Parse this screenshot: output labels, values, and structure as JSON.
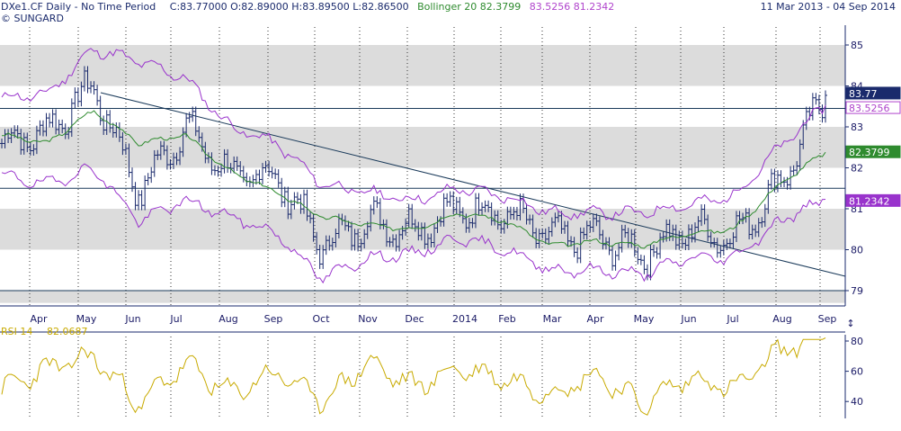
{
  "header": {
    "instrument": "DXe1.CF Daily",
    "sep": " - ",
    "period": "No Time Period",
    "ohlc": "C:83.77000 O:82.89000 H:83.89500 L:82.86500",
    "bb_name": "Bollinger 20",
    "bb_mid": "82.3799",
    "bb_upper": "83.5256",
    "bb_lower": "81.2342",
    "date_range": "11 Mar 2013  -  04 Sep 2014",
    "copyright": "© SUNGARD"
  },
  "colors": {
    "price": "#1a2a6c",
    "bb_mid": "#2e8b2e",
    "bb_band": "#9933cc",
    "rsi": "#c8aa00",
    "band_fill": "#dcdcdc",
    "label_dark": "#1a2a6c",
    "label_purple": "#cc55dd",
    "label_green": "#2e8b2e"
  },
  "price_labels": {
    "last": "83.77",
    "upper": "83.5256",
    "mid": "82.3799",
    "lower": "81.2342"
  },
  "rsi": {
    "label": "RSI 14",
    "value": "82.0687",
    "ticks": [
      "80",
      "60",
      "40"
    ]
  },
  "chart_data": [
    {
      "type": "line",
      "description_series": "OHLC bars with Bollinger bands",
      "x_tick_labels": [
        "Apr",
        "May",
        "Jun",
        "Jul",
        "Aug",
        "Sep",
        "Oct",
        "Nov",
        "Dec",
        "2014",
        "Feb",
        "Mar",
        "Apr",
        "May",
        "Jun",
        "Jul",
        "Aug",
        "Sep"
      ],
      "y_tick_labels": [
        "85",
        "84",
        "83",
        "82",
        "81",
        "80",
        "79"
      ],
      "ylim": [
        78.7,
        85.7
      ],
      "grid": true,
      "series": [
        {
          "name": "DXe1.CF",
          "x": [
            "Mar13",
            "Apr13",
            "May13",
            "Jun13",
            "Jul13",
            "Aug13",
            "Sep13",
            "Oct13",
            "Nov13",
            "Dec13",
            "Jan14",
            "Feb14",
            "Mar14",
            "Apr14",
            "May14",
            "Jun14",
            "Jul14",
            "Aug14",
            "Sep14"
          ],
          "values": [
            82.6,
            82.9,
            84.0,
            81.4,
            83.0,
            81.8,
            81.8,
            80.1,
            80.7,
            80.5,
            81.0,
            80.9,
            80.3,
            80.3,
            79.9,
            80.5,
            80.3,
            81.6,
            83.77
          ]
        },
        {
          "name": "Bollinger 20",
          "values": [
            82.8,
            82.6,
            83.4,
            82.6,
            82.8,
            81.9,
            81.4,
            80.8,
            80.6,
            80.5,
            80.9,
            80.7,
            80.1,
            80.2,
            80.1,
            80.4,
            80.5,
            81.6,
            82.38
          ]
        },
        {
          "name": "upper",
          "values": [
            83.7,
            83.8,
            84.9,
            84.6,
            84.2,
            83.0,
            82.6,
            81.6,
            81.4,
            81.2,
            81.5,
            81.3,
            80.9,
            80.9,
            80.9,
            81.1,
            81.3,
            82.5,
            83.53
          ]
        },
        {
          "name": "lower",
          "values": [
            81.8,
            81.6,
            82.0,
            80.7,
            81.2,
            80.8,
            80.4,
            79.3,
            79.8,
            79.9,
            80.3,
            80.0,
            79.5,
            79.5,
            79.4,
            79.8,
            79.8,
            80.7,
            81.23
          ]
        }
      ]
    },
    {
      "type": "line",
      "yticks": [
        80,
        60,
        40
      ],
      "ylim": [
        27,
        82
      ],
      "series": [
        {
          "name": "RSI 14",
          "values": [
            48,
            62,
            70,
            38,
            65,
            45,
            60,
            40,
            66,
            50,
            62,
            55,
            45,
            58,
            38,
            56,
            48,
            74,
            82.07
          ]
        }
      ]
    }
  ]
}
